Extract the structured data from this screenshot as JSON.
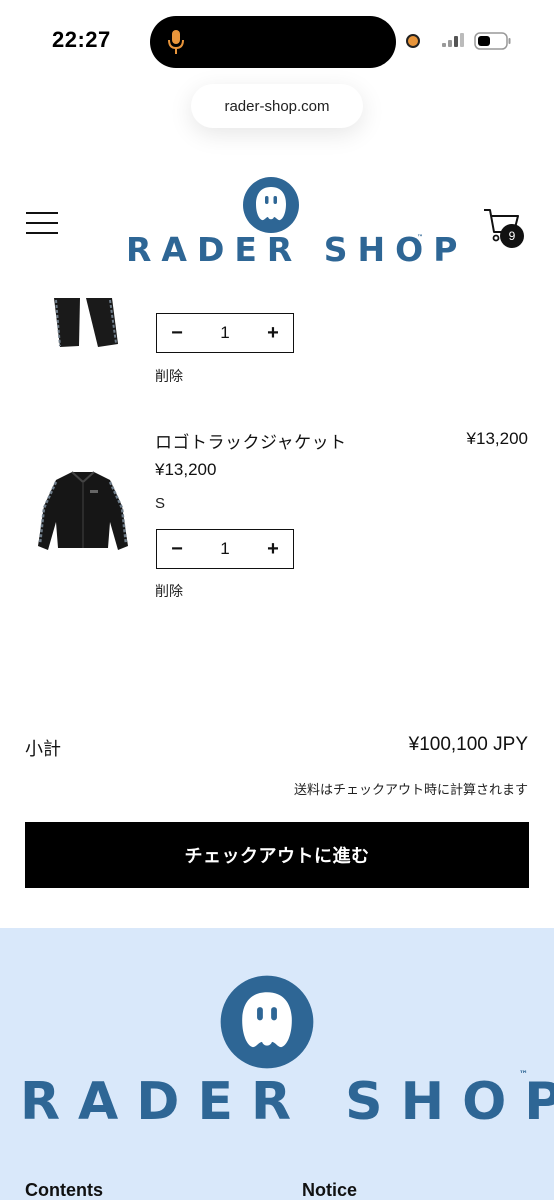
{
  "status_bar": {
    "time": "22:27",
    "icons": [
      "microphone-icon",
      "recording-dot-icon",
      "cellular-signal-icon",
      "battery-icon"
    ]
  },
  "browser": {
    "url": "rader-shop.com"
  },
  "header": {
    "logo_text": "RADER SHOP",
    "logo_tm": "™",
    "cart_count": "9",
    "icons": [
      "hamburger-menu-icon",
      "cart-icon"
    ]
  },
  "cart": {
    "items": [
      {
        "quantity": "1",
        "remove_label": "削除"
      },
      {
        "title": "ロゴトラックジャケット",
        "price": "¥13,200",
        "line_total": "¥13,200",
        "variant": "S",
        "quantity": "1",
        "remove_label": "削除"
      }
    ],
    "decrease_label": "−",
    "increase_label": "+",
    "subtotal_label": "小計",
    "subtotal_value": "¥100,100 JPY",
    "shipping_note": "送料はチェックアウト時に計算されます",
    "checkout_label": "チェックアウトに進む"
  },
  "footer": {
    "logo_text": "RADER SHOP",
    "logo_tm": "™",
    "headings": [
      "Contents",
      "Notice"
    ]
  },
  "colors": {
    "brand_blue": "#2e6695",
    "footer_bg": "#d9e8fa",
    "checkout_bg": "#000000"
  }
}
